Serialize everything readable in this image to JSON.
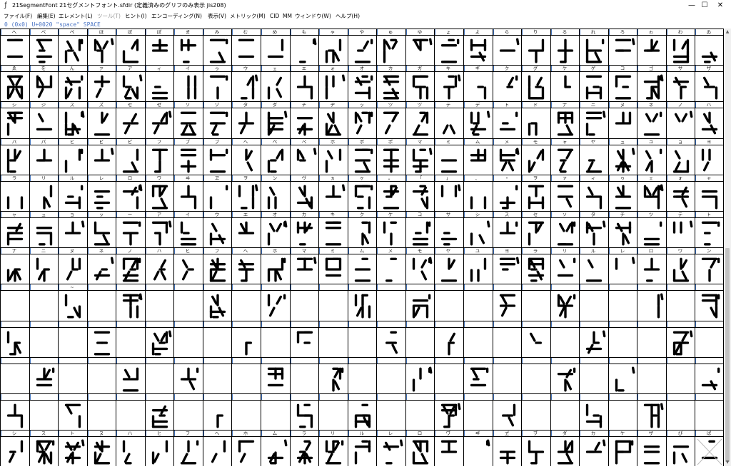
{
  "window": {
    "icon": "fontforge-icon",
    "title": "21SegmentFont  21セグメントフォント.sfdir (定義済みのグリフのみ表示 jis208)",
    "minimize": "—",
    "maximize": "☐",
    "close": "✕"
  },
  "menu": [
    {
      "label": "ファイル(F)",
      "enabled": true
    },
    {
      "label": "編集(E)",
      "enabled": true
    },
    {
      "label": "エレメント(L)",
      "enabled": true
    },
    {
      "label": "ツール(T)",
      "enabled": false
    },
    {
      "label": "ヒント(I)",
      "enabled": true
    },
    {
      "label": "エンコーディング(N)",
      "enabled": true
    },
    {
      "label": "表示(V)",
      "enabled": true
    },
    {
      "label": "メトリック(M)",
      "enabled": true
    },
    {
      "label": "CID",
      "enabled": true
    },
    {
      "label": "MM",
      "enabled": true
    },
    {
      "label": "ウィンドウ(W)",
      "enabled": true
    },
    {
      "label": "ヘルプ(H)",
      "enabled": true
    }
  ],
  "info_line": "0 (0x0) U+0020 \"space\" SPACE",
  "colors": {
    "label_tick": "#3f6fb5",
    "info_text": "#4a74c4",
    "glyph": "#000000"
  },
  "glyph_rows": [
    {
      "labels": [
        "へ",
        "べ",
        "ぺ",
        "ほ",
        "ぼ",
        "ぽ",
        "ま",
        "み",
        "む",
        "め",
        "も",
        "ゃ",
        "や",
        "ゅ",
        "ゆ",
        "ょ",
        "よ",
        "ら",
        "り",
        "る",
        "れ",
        "ろ",
        "ゎ",
        "わ",
        "ゐ"
      ]
    },
    {
      "labels": [
        "ゑ",
        "を",
        "ん",
        "ァ",
        "ア",
        "ィ",
        "イ",
        "ゥ",
        "ウ",
        "ェ",
        "エ",
        "ォ",
        "オ",
        "カ",
        "ガ",
        "キ",
        "ギ",
        "ク",
        "グ",
        "ケ",
        "ゲ",
        "コ",
        "ゴ",
        "サ",
        "ザ"
      ]
    },
    {
      "labels": [
        "シ",
        "ジ",
        "ス",
        "ズ",
        "セ",
        "ゼ",
        "ソ",
        "ゾ",
        "タ",
        "ダ",
        "チ",
        "ヂ",
        "ッ",
        "ツ",
        "ヅ",
        "テ",
        "デ",
        "ト",
        "ド",
        "ナ",
        "ニ",
        "ヌ",
        "ネ",
        "ノ",
        "ハ"
      ]
    },
    {
      "labels": [
        "バ",
        "パ",
        "ヒ",
        "ビ",
        "ピ",
        "フ",
        "ブ",
        "プ",
        "ヘ",
        "ベ",
        "ペ",
        "ホ",
        "ボ",
        "ポ",
        "マ",
        "ミ",
        "ム",
        "メ",
        "モ",
        "ャ",
        "ヤ",
        "ュ",
        "ユ",
        "ョ",
        "ヨ"
      ]
    },
    {
      "labels": [
        "ラ",
        "リ",
        "ル",
        "レ",
        "ロ",
        "ワ",
        "ヰ",
        "ヱ",
        "ヲ",
        "ン",
        "ヴ",
        "ヵ",
        "ヶ",
        "。",
        "「",
        "」",
        "、",
        "・",
        "ヲ",
        "ァ",
        "ィ",
        "ゥ",
        "ェ",
        "ォ",
        "ャ"
      ]
    },
    {
      "labels": [
        "ャ",
        "ュ",
        "ョ",
        "ッ",
        "ー",
        "ア",
        "イ",
        "ウ",
        "エ",
        "オ",
        "カ",
        "キ",
        "ク",
        "ケ",
        "コ",
        "サ",
        "シ",
        "ス",
        "セ",
        "ソ",
        "タ",
        "チ",
        "ツ",
        "テ",
        "ト"
      ]
    },
    {
      "labels": [
        "ナ",
        "ニ",
        "ヌ",
        "ネ",
        "ノ",
        "ハ",
        "ヒ",
        "フ",
        "ヘ",
        "ホ",
        "マ",
        "ミ",
        "ム",
        "メ",
        "モ",
        "ヤ",
        "ユ",
        "ヨ",
        "ラ",
        "リ",
        "ル",
        "レ",
        "ロ",
        "ワ",
        "ン"
      ]
    },
    {
      "labels": [
        "",
        "",
        "~",
        "",
        "",
        "",
        "",
        "",
        "",
        "",
        "",
        "",
        "",
        "",
        "",
        "",
        "",
        "",
        "",
        "",
        "",
        "",
        "",
        "",
        ""
      ]
    },
    {
      "labels": [
        "",
        "",
        "",
        "",
        "",
        "",
        "",
        "",
        "",
        "",
        "",
        "",
        "",
        "",
        "",
        "",
        "",
        "",
        "",
        "",
        "",
        "",
        "",
        "",
        ""
      ]
    },
    {
      "labels": [
        "",
        "",
        "",
        "",
        "",
        "",
        "",
        "",
        "",
        "",
        "",
        "",
        "",
        "",
        "",
        "",
        "",
        "",
        "",
        "",
        "",
        "",
        "",
        "",
        ""
      ]
    },
    {
      "labels": [
        "",
        "",
        "",
        "",
        "",
        "",
        "",
        "",
        "",
        "",
        "",
        "",
        "",
        "",
        "",
        "",
        "",
        "",
        "",
        "",
        "",
        "",
        "",
        "",
        ""
      ]
    },
    {
      "labels": [
        "シ",
        "ス",
        "ト",
        "ヌ",
        "ハ",
        "ヒ",
        "フ",
        "ヘ",
        "ホ",
        "ム",
        "ラ",
        "リ",
        "ル",
        "レ",
        "ロ",
        "ヷ",
        "ヸ",
        "ヹ",
        "ヺ",
        "ダ",
        "カ",
        "ケ",
        "ザ",
        "ぴ",
        "ぱ"
      ]
    }
  ]
}
